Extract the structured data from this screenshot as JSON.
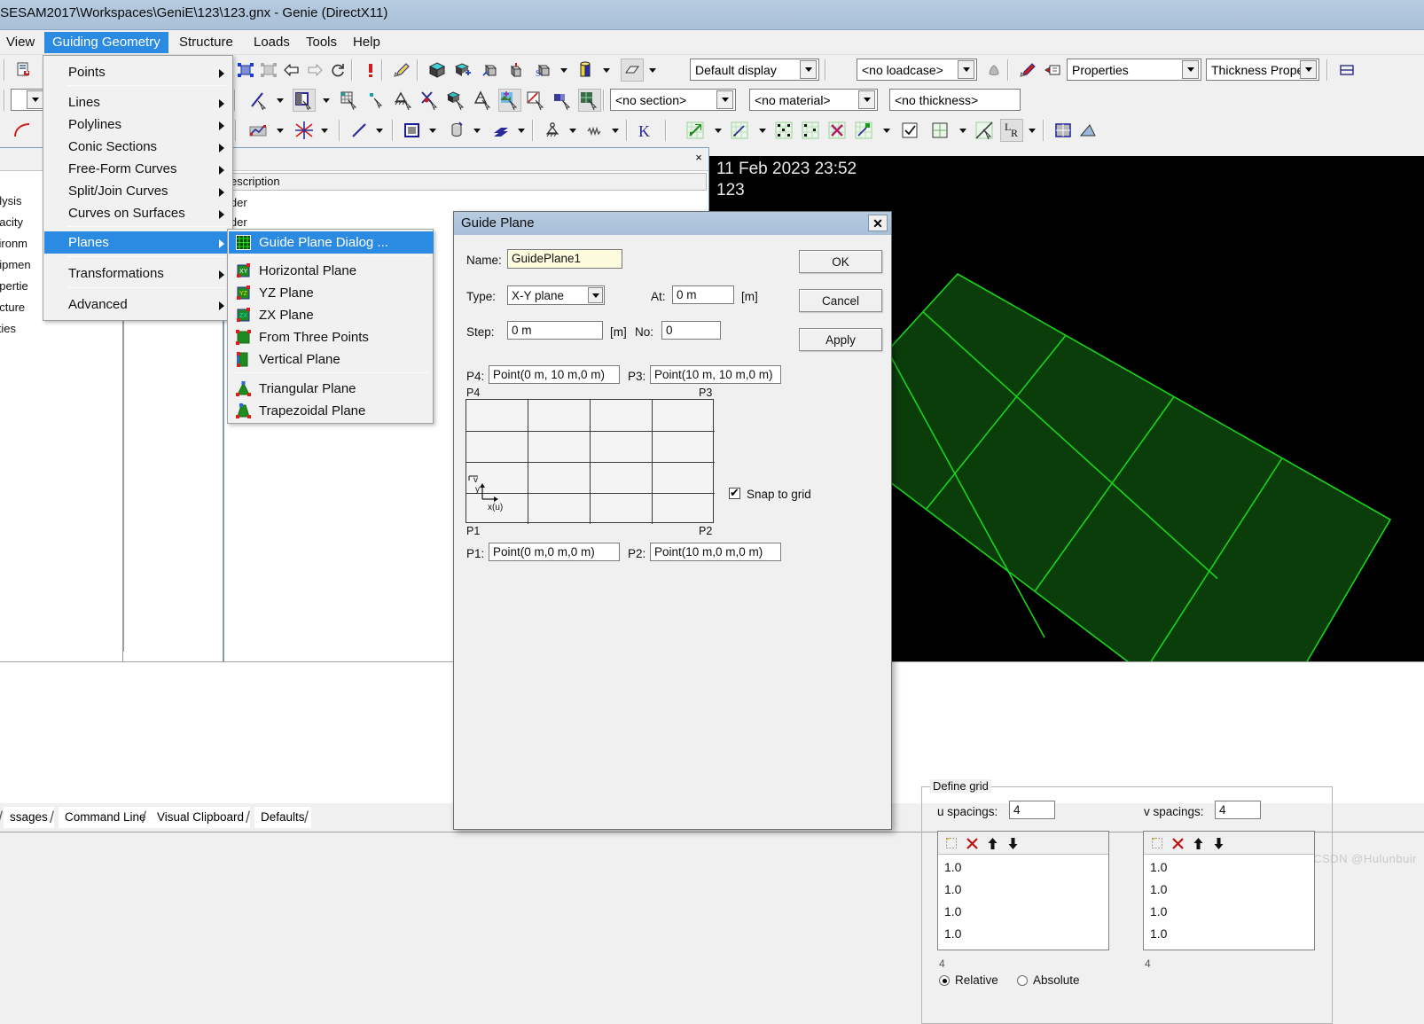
{
  "window": {
    "title": "\\SESAM2017\\Workspaces\\GeniE\\123\\123.gnx - Genie (DirectX11)"
  },
  "menubar": {
    "items": [
      {
        "label": "View",
        "selected": false
      },
      {
        "label": "Guiding Geometry",
        "selected": true
      },
      {
        "label": "Structure",
        "selected": false
      },
      {
        "label": "Loads",
        "selected": false
      },
      {
        "label": "Tools",
        "selected": false
      },
      {
        "label": "Help",
        "selected": false
      }
    ]
  },
  "toolbars": {
    "display_combo": "Default display",
    "loadcase_combo": "<no loadcase>",
    "properties_combo": "Properties",
    "thickness_combo": "Thickness Property",
    "section_combo": "<no section>",
    "material_combo": "<no material>",
    "thickness_sel_combo": "<no thickness>"
  },
  "guiding_geometry_menu": {
    "items": [
      {
        "label": "Points",
        "has_submenu": true,
        "selected": false
      },
      {
        "label": "Lines",
        "has_submenu": true,
        "selected": false
      },
      {
        "label": "Polylines",
        "has_submenu": true,
        "selected": false
      },
      {
        "label": "Conic Sections",
        "has_submenu": true,
        "selected": false
      },
      {
        "label": "Free-Form Curves",
        "has_submenu": true,
        "selected": false
      },
      {
        "label": "Split/Join Curves",
        "has_submenu": true,
        "selected": false
      },
      {
        "label": "Curves on Surfaces",
        "has_submenu": true,
        "selected": false
      },
      {
        "label": "Planes",
        "has_submenu": true,
        "selected": true
      },
      {
        "label": "Transformations",
        "has_submenu": true,
        "selected": false
      },
      {
        "label": "Advanced",
        "has_submenu": true,
        "selected": false
      }
    ]
  },
  "planes_submenu": {
    "items": [
      {
        "label": "Guide Plane Dialog ...",
        "icon": "guide-plane-grid-icon",
        "selected": true
      },
      {
        "label": "Horizontal Plane",
        "icon": "xy-plane-icon",
        "selected": false
      },
      {
        "label": "YZ Plane",
        "icon": "yz-plane-icon",
        "selected": false
      },
      {
        "label": "ZX Plane",
        "icon": "zx-plane-icon",
        "selected": false
      },
      {
        "label": "From Three Points",
        "icon": "three-points-plane-icon",
        "selected": false
      },
      {
        "label": "Vertical Plane",
        "icon": "vertical-plane-icon",
        "selected": false
      },
      {
        "label": "Triangular Plane",
        "icon": "triangular-plane-icon",
        "selected": false
      },
      {
        "label": "Trapezoidal Plane",
        "icon": "trapezoidal-plane-icon",
        "selected": false
      }
    ]
  },
  "left_panel": {
    "rows": [
      "alysis",
      "pacity",
      "vironm",
      "uipmen",
      "opertie",
      "ucture",
      "lities"
    ]
  },
  "mid_panel": {
    "column_header": "escription",
    "rows": [
      "lder",
      "lder"
    ]
  },
  "viewport": {
    "timestamp": "11 Feb 2023 23:52",
    "model_name": "123",
    "background_color": "#000000",
    "grid_color": "#19d419",
    "grid_fill_color": "#0b3d0b",
    "grid_divisions_u": 4,
    "grid_divisions_v": 4
  },
  "dialog": {
    "title": "Guide Plane",
    "close_label": "✕",
    "name_label": "Name:",
    "name_value": "GuidePlane1",
    "type_label": "Type:",
    "type_value": "X-Y plane",
    "at_label": "At:",
    "at_value": "0 m",
    "at_unit": "[m]",
    "step_label": "Step:",
    "step_value": "0 m",
    "step_unit": "[m]",
    "no_label": "No:",
    "no_value": "0",
    "p4_label": "P4:",
    "p4_value": "Point(0 m, 10 m,0 m)",
    "p3_label": "P3:",
    "p3_value": "Point(10 m, 10 m,0 m)",
    "p1_label": "P1:",
    "p1_value": "Point(0 m,0 m,0 m)",
    "p2_label": "P2:",
    "p2_value": "Point(10 m,0 m,0 m)",
    "corner_p4": "P4",
    "corner_p3": "P3",
    "corner_p1": "P1",
    "corner_p2": "P2",
    "axis_v": "v",
    "axis_y": "y",
    "axis_xu": "x(u)",
    "snap_label": "Snap to grid",
    "snap_checked": true,
    "buttons": {
      "ok": "OK",
      "cancel": "Cancel",
      "apply": "Apply"
    },
    "define_grid": {
      "legend": "Define grid",
      "u_label": "u spacings:",
      "u_count": "4",
      "v_label": "v spacings:",
      "v_count": "4",
      "u_values": [
        "1.0",
        "1.0",
        "1.0",
        "1.0"
      ],
      "v_values": [
        "1.0",
        "1.0",
        "1.0",
        "1.0"
      ],
      "u_total": "4",
      "v_total": "4",
      "list_tools": [
        "new-item-icon",
        "delete-item-icon",
        "move-up-icon",
        "move-down-icon"
      ],
      "relative_label": "Relative",
      "absolute_label": "Absolute",
      "mode_selected": "Relative"
    }
  },
  "bottom_tabs": {
    "items": [
      "ssages",
      "Command Line",
      "Visual Clipboard",
      "Defaults"
    ]
  },
  "watermark": "CSDN @Hulunbuir"
}
